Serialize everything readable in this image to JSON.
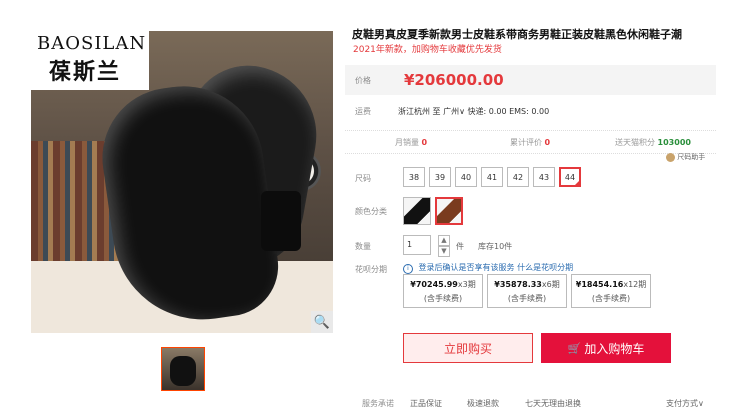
{
  "gallery": {
    "brand_en": "BAOSILAN",
    "brand_cn": "葆斯兰",
    "zoom_icon": "magnifier-icon"
  },
  "product": {
    "title": "皮鞋男真皮夏季新款男士皮鞋系带商务男鞋正装皮鞋黑色休闲鞋子潮",
    "promo": "2021年新款，加购物车收藏优先发货"
  },
  "price": {
    "label": "价格",
    "value": "¥206000.00"
  },
  "shipping": {
    "label": "运费",
    "text": "浙江杭州 至 广州∨ 快递: 0.00 EMS: 0.00"
  },
  "stats": {
    "monthly_label": "月销量",
    "monthly_value": "0",
    "reviews_label": "累计评价",
    "reviews_value": "0",
    "points_label": "送天猫积分",
    "points_value": "103000"
  },
  "size_helper": "尺码助手",
  "size": {
    "label": "尺码",
    "options": [
      "38",
      "39",
      "40",
      "41",
      "42",
      "43",
      "44"
    ],
    "selected": "44"
  },
  "color": {
    "label": "颜色分类",
    "options": [
      "black",
      "brown"
    ],
    "selected": "brown"
  },
  "quantity": {
    "label": "数量",
    "value": "1",
    "unit": "件",
    "stock": "库存10件"
  },
  "installment": {
    "label": "花呗分期",
    "note": "登录后确认是否享有该服务",
    "link": "什么是花呗分期",
    "plans": [
      {
        "amount": "¥70245.99",
        "period": "x3期",
        "fee": "(含手续费)"
      },
      {
        "amount": "¥35878.33",
        "period": "x6期",
        "fee": "(含手续费)"
      },
      {
        "amount": "¥18454.16",
        "period": "x12期",
        "fee": "(含手续费)"
      }
    ]
  },
  "actions": {
    "buy_now": "立即购买",
    "add_cart": "加入购物车"
  },
  "service": {
    "label": "服务承诺",
    "items": [
      "正品保证",
      "极速退款",
      "七天无理由退换"
    ],
    "payment": "支付方式∨"
  },
  "colors": {
    "accent": "#e4393c",
    "cart_bg": "#e4113b"
  }
}
